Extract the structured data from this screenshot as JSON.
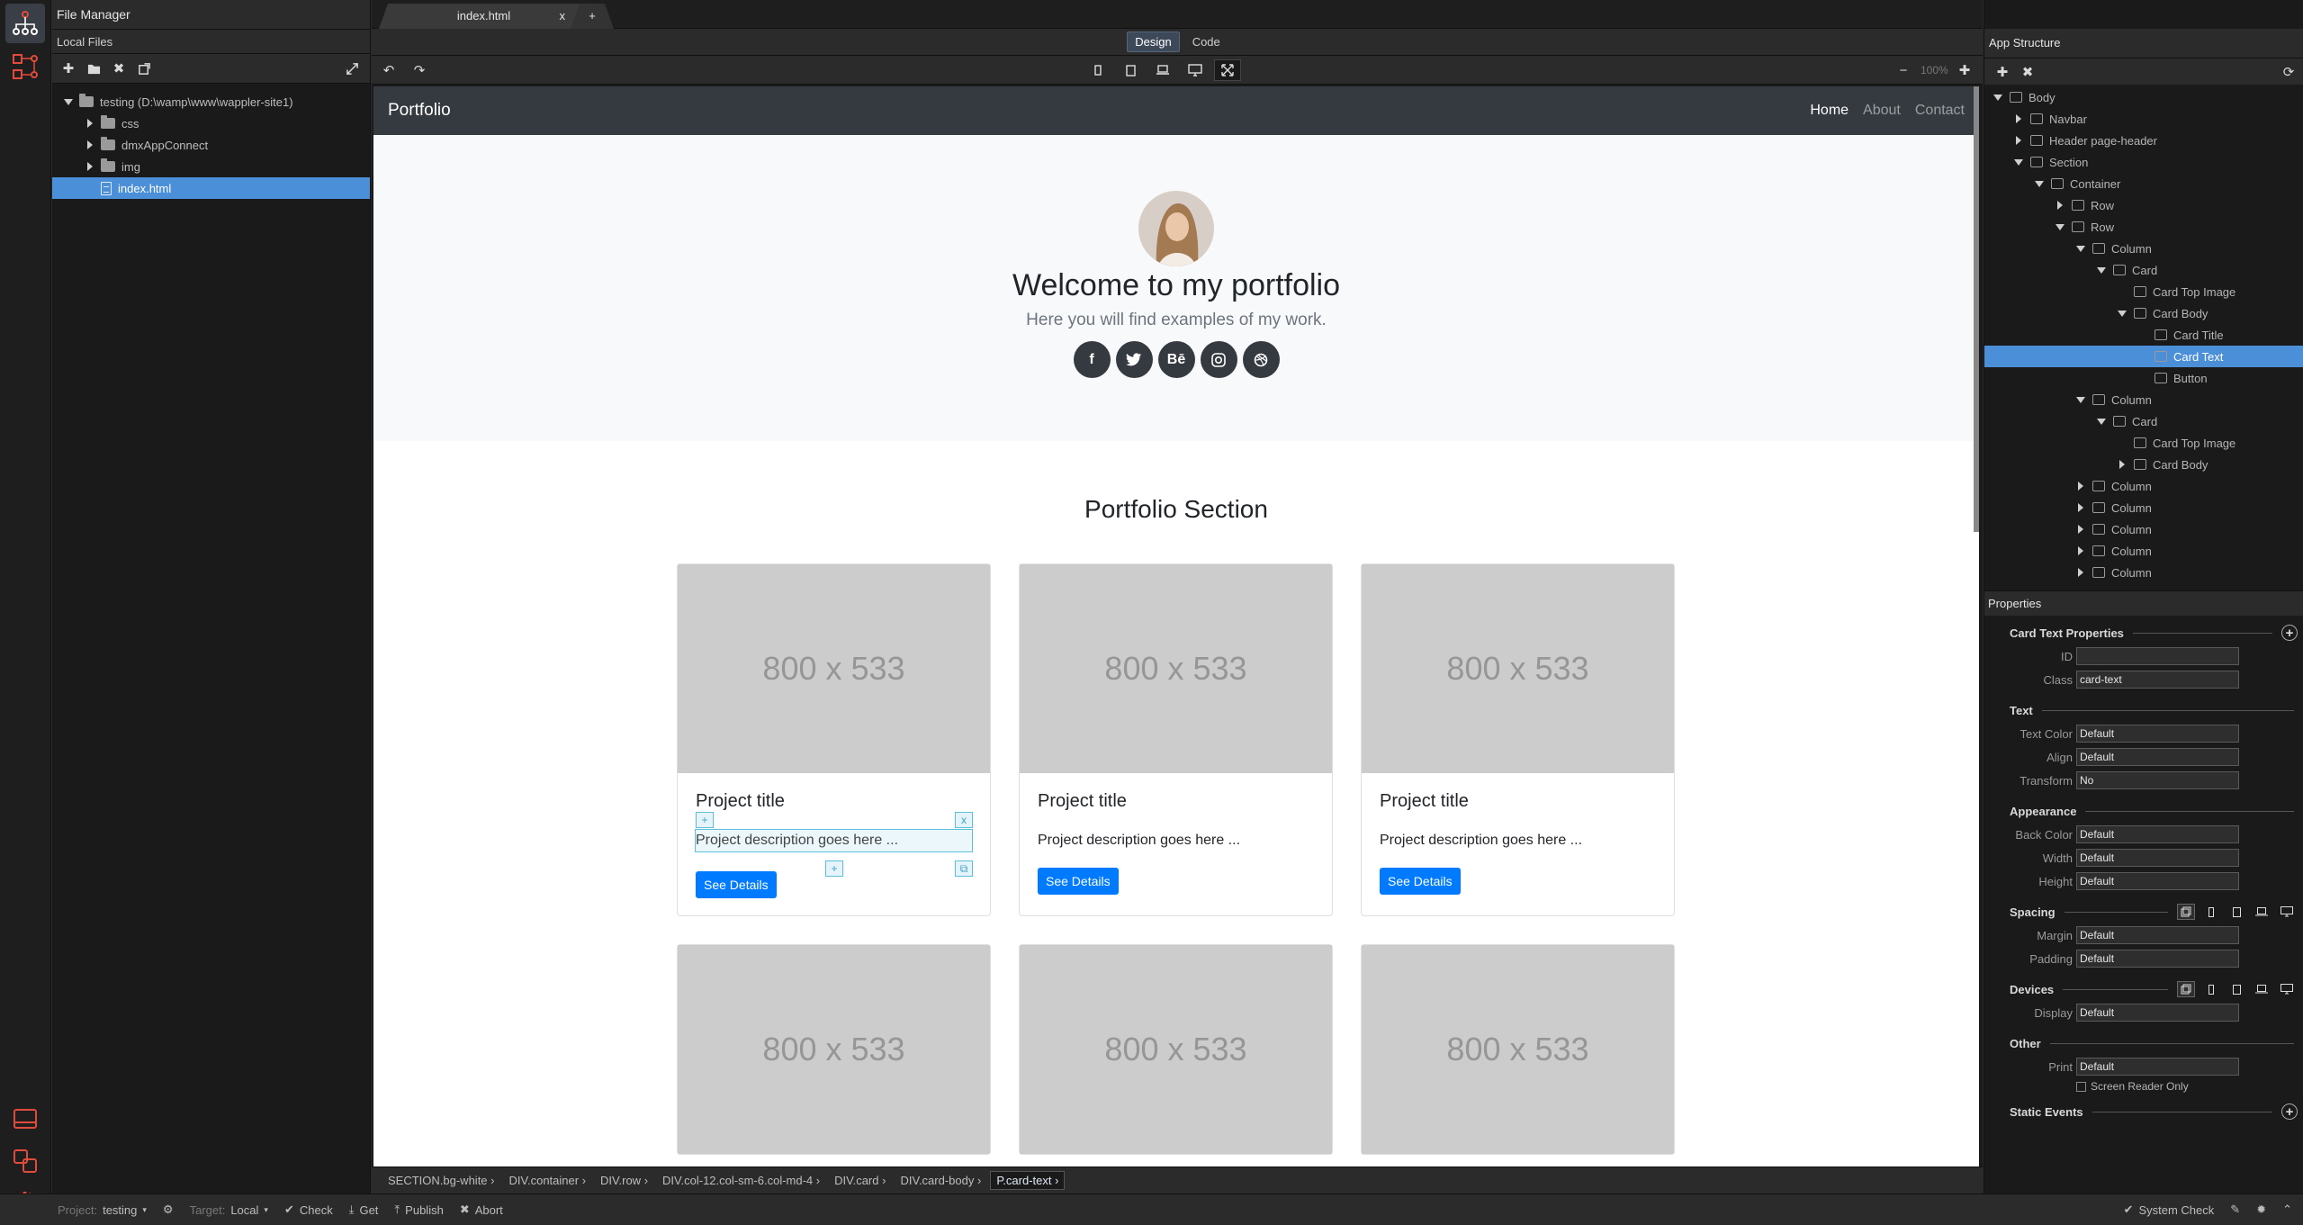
{
  "file_manager": {
    "title": "File Manager",
    "subtitle": "Local Files",
    "tree": [
      {
        "label": "testing (D:\\wamp\\www\\wappler-site1)",
        "type": "folder",
        "depth": 0,
        "open": true
      },
      {
        "label": "css",
        "type": "folder",
        "depth": 1,
        "open": false
      },
      {
        "label": "dmxAppConnect",
        "type": "folder",
        "depth": 1,
        "open": false
      },
      {
        "label": "img",
        "type": "folder",
        "depth": 1,
        "open": false
      },
      {
        "label": "index.html",
        "type": "file",
        "depth": 1,
        "selected": true
      }
    ]
  },
  "tabs": {
    "active": "index.html",
    "close": "x",
    "add": "+"
  },
  "modes": {
    "design": "Design",
    "code": "Code"
  },
  "zoom": "100%",
  "page": {
    "brand": "Portfolio",
    "nav": [
      "Home",
      "About",
      "Contact"
    ],
    "hero_title": "Welcome to my portfolio",
    "hero_subtitle": "Here you will find examples of my work.",
    "socials": [
      "facebook",
      "twitter",
      "behance",
      "instagram",
      "dribbble"
    ],
    "social_glyphs": [
      "f",
      "",
      "Bē",
      "",
      ""
    ],
    "section_title": "Portfolio Section",
    "cards": [
      {
        "img": "800 x 533",
        "title": "Project title",
        "text": "Project description goes here ...",
        "button": "See Details"
      },
      {
        "img": "800 x 533",
        "title": "Project title",
        "text": "Project description goes here ...",
        "button": "See Details"
      },
      {
        "img": "800 x 533",
        "title": "Project title",
        "text": "Project description goes here ...",
        "button": "See Details"
      },
      {
        "img": "800 x 533"
      },
      {
        "img": "800 x 533"
      },
      {
        "img": "800 x 533"
      }
    ],
    "selection_handles": {
      "add": "+",
      "remove": "x"
    }
  },
  "breadcrumbs": [
    "SECTION.bg-white",
    "DIV.container",
    "DIV.row",
    "DIV.col-12.col-sm-6.col-md-4",
    "DIV.card",
    "DIV.card-body",
    "P.card-text"
  ],
  "app_structure": {
    "title": "App Structure",
    "tree": [
      {
        "label": "Body",
        "depth": 0,
        "arrow": "down"
      },
      {
        "label": "Navbar",
        "depth": 1,
        "arrow": "right"
      },
      {
        "label": "Header page-header",
        "depth": 1,
        "arrow": "right"
      },
      {
        "label": "Section",
        "depth": 1,
        "arrow": "down"
      },
      {
        "label": "Container",
        "depth": 2,
        "arrow": "down"
      },
      {
        "label": "Row",
        "depth": 3,
        "arrow": "right"
      },
      {
        "label": "Row",
        "depth": 3,
        "arrow": "down"
      },
      {
        "label": "Column",
        "depth": 4,
        "arrow": "down"
      },
      {
        "label": "Card",
        "depth": 5,
        "arrow": "down"
      },
      {
        "label": "Card Top Image",
        "depth": 6,
        "arrow": ""
      },
      {
        "label": "Card Body",
        "depth": 6,
        "arrow": "down"
      },
      {
        "label": "Card Title",
        "depth": 7,
        "arrow": ""
      },
      {
        "label": "Card Text",
        "depth": 7,
        "arrow": "",
        "selected": true
      },
      {
        "label": "Button",
        "depth": 7,
        "arrow": ""
      },
      {
        "label": "Column",
        "depth": 4,
        "arrow": "down"
      },
      {
        "label": "Card",
        "depth": 5,
        "arrow": "down"
      },
      {
        "label": "Card Top Image",
        "depth": 6,
        "arrow": ""
      },
      {
        "label": "Card Body",
        "depth": 6,
        "arrow": "right"
      },
      {
        "label": "Column",
        "depth": 4,
        "arrow": "right"
      },
      {
        "label": "Column",
        "depth": 4,
        "arrow": "right"
      },
      {
        "label": "Column",
        "depth": 4,
        "arrow": "right"
      },
      {
        "label": "Column",
        "depth": 4,
        "arrow": "right"
      },
      {
        "label": "Column",
        "depth": 4,
        "arrow": "right"
      }
    ]
  },
  "properties": {
    "title": "Properties",
    "card_text_props": "Card Text Properties",
    "id_label": "ID",
    "id_value": "",
    "class_label": "Class",
    "class_value": "card-text",
    "text": "Text",
    "text_color_label": "Text Color",
    "text_color": "Default",
    "align_label": "Align",
    "align": "Default",
    "transform_label": "Transform",
    "transform": "No",
    "appearance": "Appearance",
    "back_color_label": "Back Color",
    "back_color": "Default",
    "width_label": "Width",
    "width": "Default",
    "height_label": "Height",
    "height": "Default",
    "spacing": "Spacing",
    "margin_label": "Margin",
    "margin": "Default",
    "padding_label": "Padding",
    "padding": "Default",
    "devices": "Devices",
    "display_label": "Display",
    "display": "Default",
    "other": "Other",
    "print_label": "Print",
    "print": "Default",
    "screen_reader": "Screen Reader Only",
    "static_events": "Static Events"
  },
  "status": {
    "project_label": "Project:",
    "project": "testing",
    "target_label": "Target:",
    "target": "Local",
    "check": "Check",
    "get": "Get",
    "publish": "Publish",
    "abort": "Abort",
    "system_check": "System Check"
  },
  "colors": {
    "accent": "#4a8fd8",
    "primary_button": "#007bff",
    "navbar": "#343a40"
  }
}
